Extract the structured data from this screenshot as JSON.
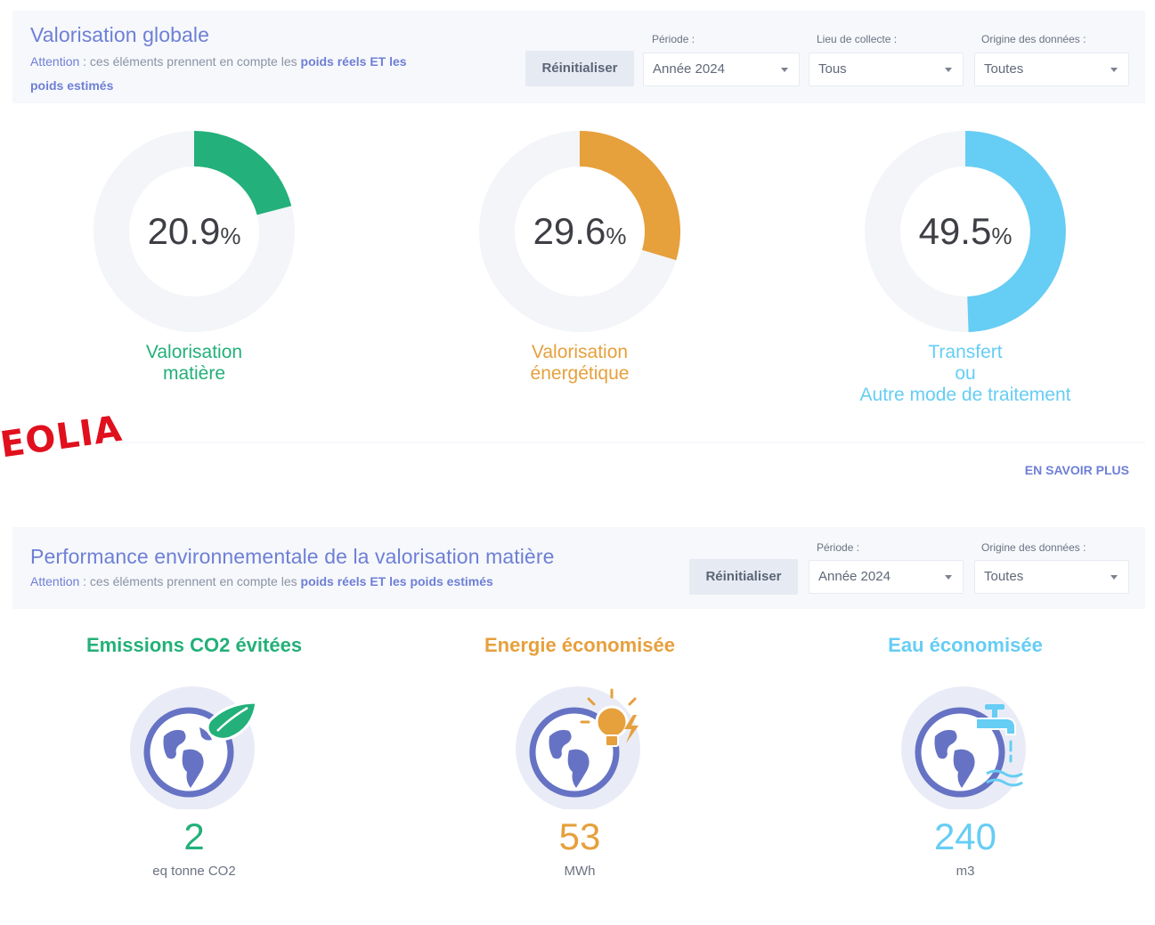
{
  "colors": {
    "accent": "#6e7fd6",
    "green": "#23b07a",
    "orange": "#e6a03c",
    "blue": "#66cdf4",
    "track": "#f3f5f8",
    "watermark": "#e0101d"
  },
  "panel1": {
    "title": "Valorisation globale",
    "note_attention": "Attention",
    "note_mid": " : ces éléments prennent en compte les ",
    "note_bold": "poids réels ET les",
    "note_line2": "poids estimés",
    "reset_label": "Réinitialiser",
    "filters": [
      {
        "label": "Période :",
        "value": "Année 2024"
      },
      {
        "label": "Lieu de collecte :",
        "value": "Tous"
      },
      {
        "label": "Origine des données :",
        "value": "Toutes"
      }
    ],
    "donuts": [
      {
        "value": "20.9",
        "percent": 20.9,
        "unit": "%",
        "line1": "Valorisation",
        "line2": "matière",
        "line3": ""
      },
      {
        "value": "29.6",
        "percent": 29.6,
        "unit": "%",
        "line1": "Valorisation",
        "line2": "énergétique",
        "line3": ""
      },
      {
        "value": "49.5",
        "percent": 49.5,
        "unit": "%",
        "line1": "Transfert",
        "line2": "ou",
        "line3": "Autre mode de traitement"
      }
    ],
    "more_link": "EN SAVOIR PLUS"
  },
  "watermark": "EOLIA",
  "panel2": {
    "title": "Performance environnementale de la valorisation matière",
    "note_attention": "Attention",
    "note_mid": " : ces éléments prennent en compte les ",
    "note_bold": "poids réels ET les poids estimés",
    "reset_label": "Réinitialiser",
    "filters": [
      {
        "label": "Période :",
        "value": "Année 2024"
      },
      {
        "label": "Origine des données :",
        "value": "Toutes"
      }
    ],
    "kpis": [
      {
        "title": "Emissions CO2 évitées",
        "value": "2",
        "unit": "eq tonne CO2",
        "icon": "earth-leaf-icon"
      },
      {
        "title": "Energie économisée",
        "value": "53",
        "unit": "MWh",
        "icon": "earth-bulb-icon"
      },
      {
        "title": "Eau économisée",
        "value": "240",
        "unit": "m3",
        "icon": "earth-faucet-icon"
      }
    ]
  }
}
